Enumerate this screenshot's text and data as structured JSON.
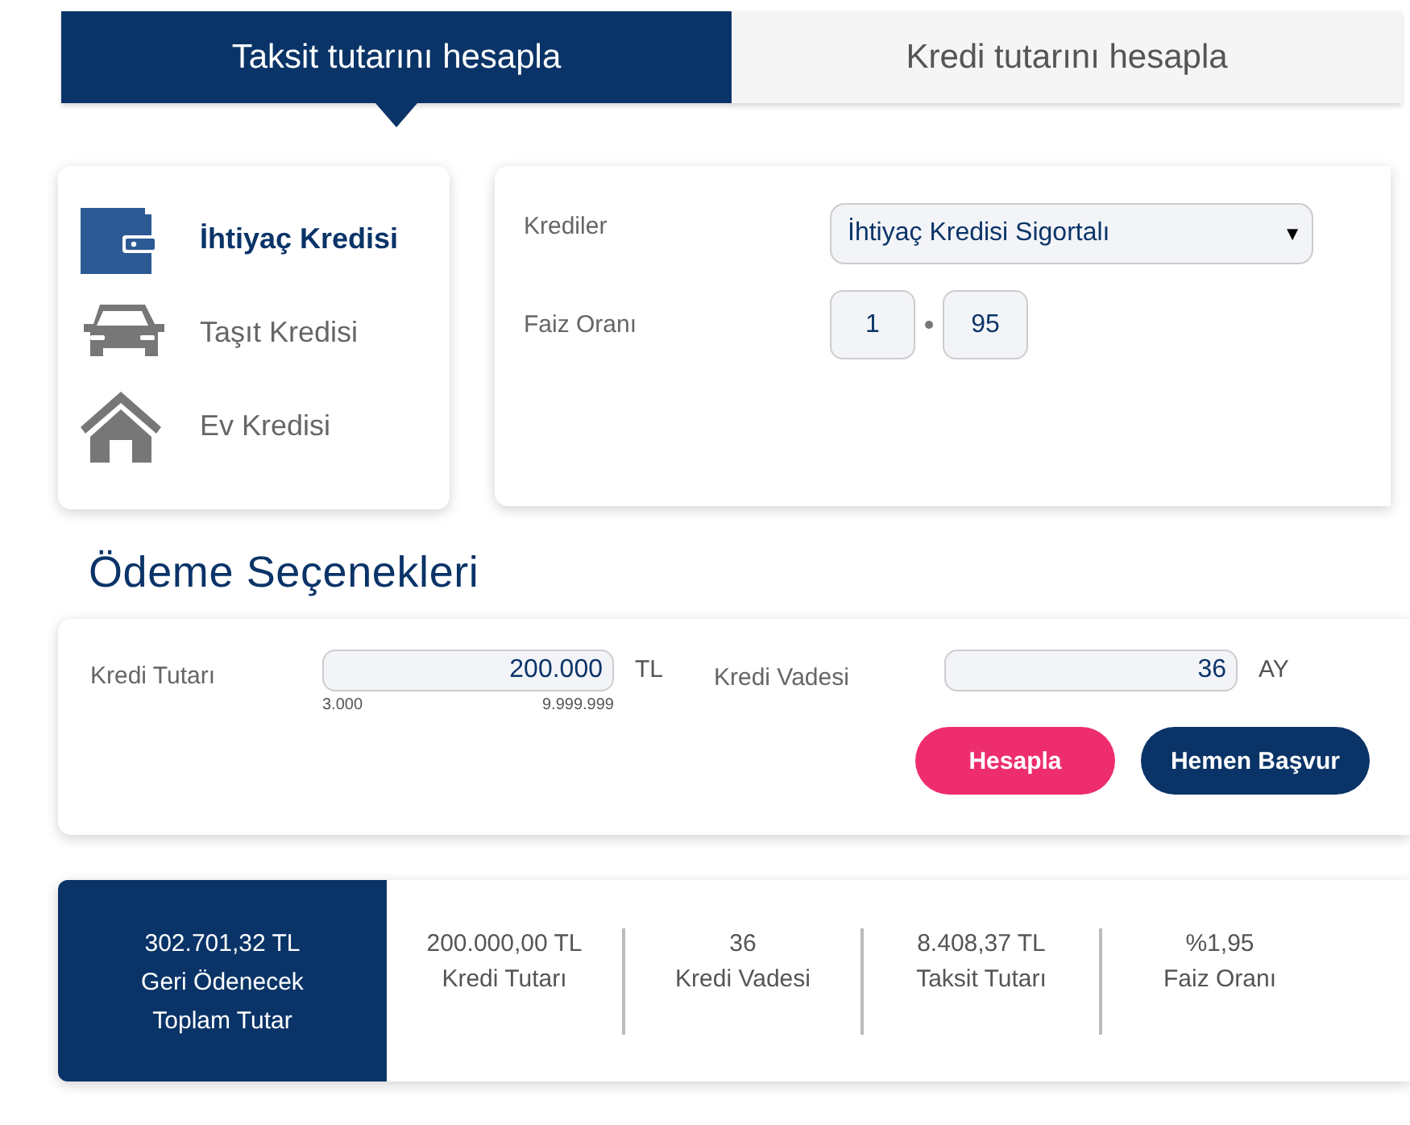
{
  "tabs": [
    {
      "label": "Taksit tutarını hesapla",
      "selected": true
    },
    {
      "label": "Kredi tutarını hesapla",
      "selected": false
    }
  ],
  "loan_types": [
    {
      "label": "İhtiyaç Kredisi",
      "kind": "wallet",
      "selected": true
    },
    {
      "label": "Taşıt Kredisi",
      "kind": "car",
      "selected": false
    },
    {
      "label": "Ev Kredisi",
      "kind": "house",
      "selected": false
    }
  ],
  "loan_form": {
    "product_label": "Krediler",
    "product_value": "İhtiyaç Kredisi Sigortalı",
    "dropdown_arrow": "▼",
    "rate_label": "Faiz Oranı",
    "rate_whole": "1",
    "rate_fraction": "95"
  },
  "payment_options": {
    "title": "Ödeme Seçenekleri",
    "amount_label": "Kredi Tutarı",
    "amount_value": "200.000",
    "amount_unit": "TL",
    "amount_min": "3.000",
    "amount_max": "9.999.999",
    "term_label": "Kredi Vadesi",
    "term_value": "36",
    "term_unit": "AY",
    "buttons": [
      {
        "label": "Hesapla",
        "kind": "primary"
      },
      {
        "label": "Hemen Başvur",
        "kind": "secondary"
      }
    ]
  },
  "summary": {
    "total_value": "302.701,32 TL",
    "total_label": "Geri Ödenecek Toplam Tutar",
    "items": [
      {
        "value": "200.000,00 TL",
        "label": "Kredi Tutarı"
      },
      {
        "value": "36",
        "label": "Kredi Vadesi"
      },
      {
        "value": "8.408,37 TL",
        "label": "Taksit Tutarı"
      },
      {
        "value": "%1,95",
        "label": "Faiz Oranı"
      }
    ]
  }
}
